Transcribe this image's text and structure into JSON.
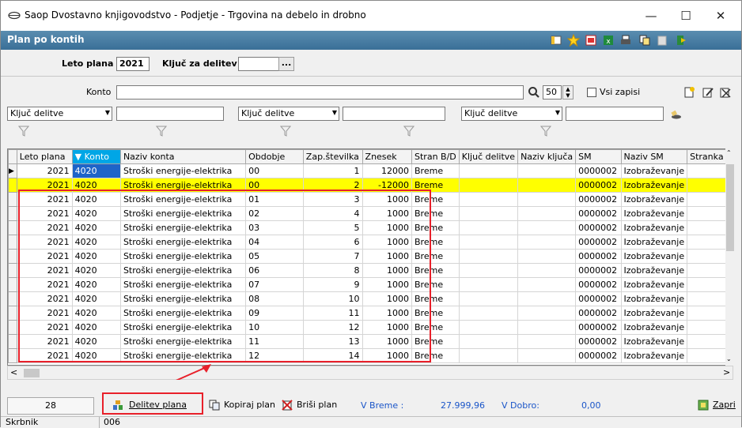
{
  "window": {
    "title": "Saop Dvostavno knjigovodstvo - Podjetje - Trgovina na debelo in drobno"
  },
  "header": {
    "title": "Plan po kontih"
  },
  "form": {
    "leto_label": "Leto plana",
    "leto_value": "2021",
    "kljuc_label": "Ključ za delitev",
    "kljuc_value": "",
    "kljuc_button": "..."
  },
  "filter": {
    "konto_label": "Konto",
    "konto_value": "",
    "limit_value": "50",
    "vsi_zapisi_label": "Vsi zapisi",
    "kljuc1": "Ključ delitve",
    "kljuc2": "Ključ delitve",
    "kljuc3": "Ključ delitve"
  },
  "grid": {
    "columns": [
      "Leto plana",
      "Konto",
      "Naziv konta",
      "Obdobje",
      "Zap.številka",
      "Znesek",
      "Stran B/D",
      "Ključ delitve",
      "Naziv ključa",
      "SM",
      "Naziv SM",
      "Stranka"
    ],
    "rows": [
      [
        "2021",
        "4020",
        "Stroški energije-elektrika",
        "00",
        "1",
        "12000",
        "Breme",
        "",
        "",
        "0000002",
        "Izobraževanje",
        ""
      ],
      [
        "2021",
        "4020",
        "Stroški energije-elektrika",
        "00",
        "2",
        "-12000",
        "Breme",
        "",
        "",
        "0000002",
        "Izobraževanje",
        ""
      ],
      [
        "2021",
        "4020",
        "Stroški energije-elektrika",
        "01",
        "3",
        "1000",
        "Breme",
        "",
        "",
        "0000002",
        "Izobraževanje",
        ""
      ],
      [
        "2021",
        "4020",
        "Stroški energije-elektrika",
        "02",
        "4",
        "1000",
        "Breme",
        "",
        "",
        "0000002",
        "Izobraževanje",
        ""
      ],
      [
        "2021",
        "4020",
        "Stroški energije-elektrika",
        "03",
        "5",
        "1000",
        "Breme",
        "",
        "",
        "0000002",
        "Izobraževanje",
        ""
      ],
      [
        "2021",
        "4020",
        "Stroški energije-elektrika",
        "04",
        "6",
        "1000",
        "Breme",
        "",
        "",
        "0000002",
        "Izobraževanje",
        ""
      ],
      [
        "2021",
        "4020",
        "Stroški energije-elektrika",
        "05",
        "7",
        "1000",
        "Breme",
        "",
        "",
        "0000002",
        "Izobraževanje",
        ""
      ],
      [
        "2021",
        "4020",
        "Stroški energije-elektrika",
        "06",
        "8",
        "1000",
        "Breme",
        "",
        "",
        "0000002",
        "Izobraževanje",
        ""
      ],
      [
        "2021",
        "4020",
        "Stroški energije-elektrika",
        "07",
        "9",
        "1000",
        "Breme",
        "",
        "",
        "0000002",
        "Izobraževanje",
        ""
      ],
      [
        "2021",
        "4020",
        "Stroški energije-elektrika",
        "08",
        "10",
        "1000",
        "Breme",
        "",
        "",
        "0000002",
        "Izobraževanje",
        ""
      ],
      [
        "2021",
        "4020",
        "Stroški energije-elektrika",
        "09",
        "11",
        "1000",
        "Breme",
        "",
        "",
        "0000002",
        "Izobraževanje",
        ""
      ],
      [
        "2021",
        "4020",
        "Stroški energije-elektrika",
        "10",
        "12",
        "1000",
        "Breme",
        "",
        "",
        "0000002",
        "Izobraževanje",
        ""
      ],
      [
        "2021",
        "4020",
        "Stroški energije-elektrika",
        "11",
        "13",
        "1000",
        "Breme",
        "",
        "",
        "0000002",
        "Izobraževanje",
        ""
      ],
      [
        "2021",
        "4020",
        "Stroški energije-elektrika",
        "12",
        "14",
        "1000",
        "Breme",
        "",
        "",
        "0000002",
        "Izobraževanje",
        ""
      ]
    ]
  },
  "bottom": {
    "count": "28",
    "delitev_label": "Delitev plana",
    "kopiraj_label": "Kopiraj plan",
    "brisi_label": "Briši plan",
    "vbreme_label": "V Breme :",
    "vbreme_value": "27.999,96",
    "vdobro_label": "V Dobro:",
    "vdobro_value": "0,00",
    "zapri_label": "Zapri"
  },
  "status": {
    "label": "Skrbnik",
    "value": "006"
  },
  "colors": {
    "header": "#3a6f97",
    "highlight": "#ffff00",
    "sort": "#00a6e6",
    "annotation": "#e8202a",
    "link": "#1a55c8"
  }
}
